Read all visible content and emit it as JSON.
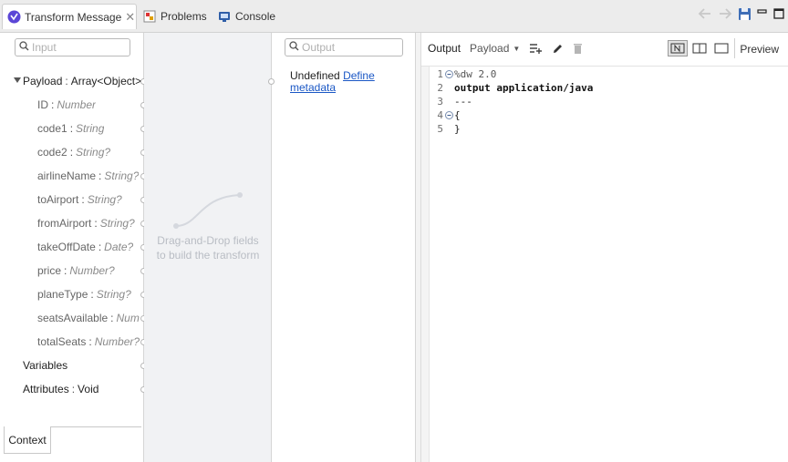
{
  "tabs": [
    {
      "label": "Transform Message",
      "active": true
    },
    {
      "label": "Problems",
      "active": false
    },
    {
      "label": "Console",
      "active": false
    }
  ],
  "input_panel": {
    "search_placeholder": "Input",
    "root": {
      "name": "Payload",
      "type": "Array<Object>"
    },
    "fields": [
      {
        "name": "ID",
        "type": "Number"
      },
      {
        "name": "code1",
        "type": "String"
      },
      {
        "name": "code2",
        "type": "String?"
      },
      {
        "name": "airlineName",
        "type": "String?"
      },
      {
        "name": "toAirport",
        "type": "String?"
      },
      {
        "name": "fromAirport",
        "type": "String?"
      },
      {
        "name": "takeOffDate",
        "type": "Date?"
      },
      {
        "name": "price",
        "type": "Number?"
      },
      {
        "name": "planeType",
        "type": "String?"
      },
      {
        "name": "seatsAvailable",
        "type": "Numb"
      },
      {
        "name": "totalSeats",
        "type": "Number?"
      }
    ],
    "variables_label": "Variables",
    "attributes": {
      "name": "Attributes",
      "type": "Void"
    },
    "context_tab": "Context"
  },
  "mapping_panel": {
    "hint_line1": "Drag-and-Drop fields",
    "hint_line2": "to build the transform"
  },
  "output_panel": {
    "search_placeholder": "Output",
    "status": "Undefined",
    "define_link_part1": "Define",
    "define_link_part2": "metadata"
  },
  "editor": {
    "output_label": "Output",
    "payload_select": "Payload",
    "preview_label": "Preview",
    "lines": [
      {
        "n": "1",
        "text": "%dw 2.0",
        "style": "dir",
        "fold": true
      },
      {
        "n": "2",
        "text": "output application/java",
        "style": "kw",
        "fold": false
      },
      {
        "n": "3",
        "text": "---",
        "style": "plain",
        "fold": false
      },
      {
        "n": "4",
        "text": "{",
        "style": "plain",
        "fold": true
      },
      {
        "n": "5",
        "text": "}",
        "style": "plain",
        "fold": false
      }
    ]
  },
  "colors": {
    "accent": "#1a57c5",
    "mule_purple": "#5b46d6",
    "gutter_bg": "#f1f2f4"
  }
}
